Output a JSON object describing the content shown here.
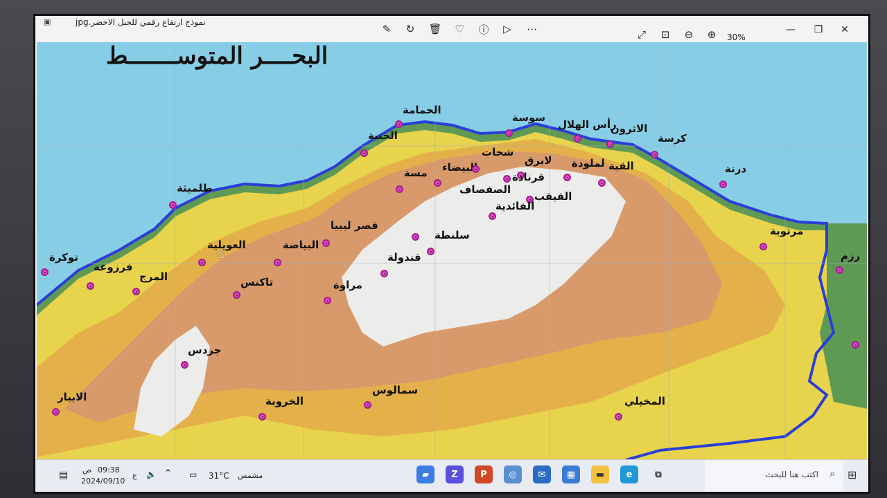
{
  "window": {
    "filename": "نموذج ارتفاع رقمي للجبل الاخضر.jpg",
    "zoom": "30%"
  },
  "toolbar": {
    "icons": [
      "edit-icon",
      "rotate-icon",
      "delete-icon",
      "favorite-icon",
      "info-icon",
      "slideshow-icon",
      "more-icon"
    ]
  },
  "map": {
    "sea_label": "البحــــر المتوســـــــط",
    "colors": {
      "sea": "#87cde6",
      "coast_green": "#5f9a55",
      "low_yellow": "#e8d34c",
      "mid_orange": "#e4b04a",
      "high_tan": "#d89a6a",
      "peak_white": "#ececea",
      "border_blue": "#2a3ed8",
      "town_magenta": "#e040c8"
    },
    "towns": [
      {
        "name": "الحمامة"
      },
      {
        "name": "سوسة"
      },
      {
        "name": "رأس الهلال"
      },
      {
        "name": "الاثرون"
      },
      {
        "name": "كرسة"
      },
      {
        "name": "الحنية"
      },
      {
        "name": "شحات"
      },
      {
        "name": "لابرق"
      },
      {
        "name": "لملودة"
      },
      {
        "name": "القبة"
      },
      {
        "name": "البيضاء"
      },
      {
        "name": "مسة"
      },
      {
        "name": "قرنادة"
      },
      {
        "name": "درنة"
      },
      {
        "name": "الصفصاف"
      },
      {
        "name": "القيقب"
      },
      {
        "name": "طلميثة"
      },
      {
        "name": "الفائدية"
      },
      {
        "name": "قصر ليبيا"
      },
      {
        "name": "سلنطة"
      },
      {
        "name": "مرتوبة"
      },
      {
        "name": "العويلية"
      },
      {
        "name": "البياضة"
      },
      {
        "name": "توكرة"
      },
      {
        "name": "قندولة"
      },
      {
        "name": "فرزوغة"
      },
      {
        "name": "المرج"
      },
      {
        "name": "تاكنس"
      },
      {
        "name": "مراوة"
      },
      {
        "name": "جردس"
      },
      {
        "name": "الابيار"
      },
      {
        "name": "سمالوس"
      },
      {
        "name": "الخروبة"
      },
      {
        "name": "المخيلي"
      },
      {
        "name": "رزم"
      }
    ]
  },
  "taskbar": {
    "time": "09:38",
    "ampm": "ص",
    "date": "2024/09/10",
    "lang": "ع",
    "temperature": "31°C",
    "weather": "مشمس",
    "search_placeholder": "اكتب هنا للبحث"
  }
}
